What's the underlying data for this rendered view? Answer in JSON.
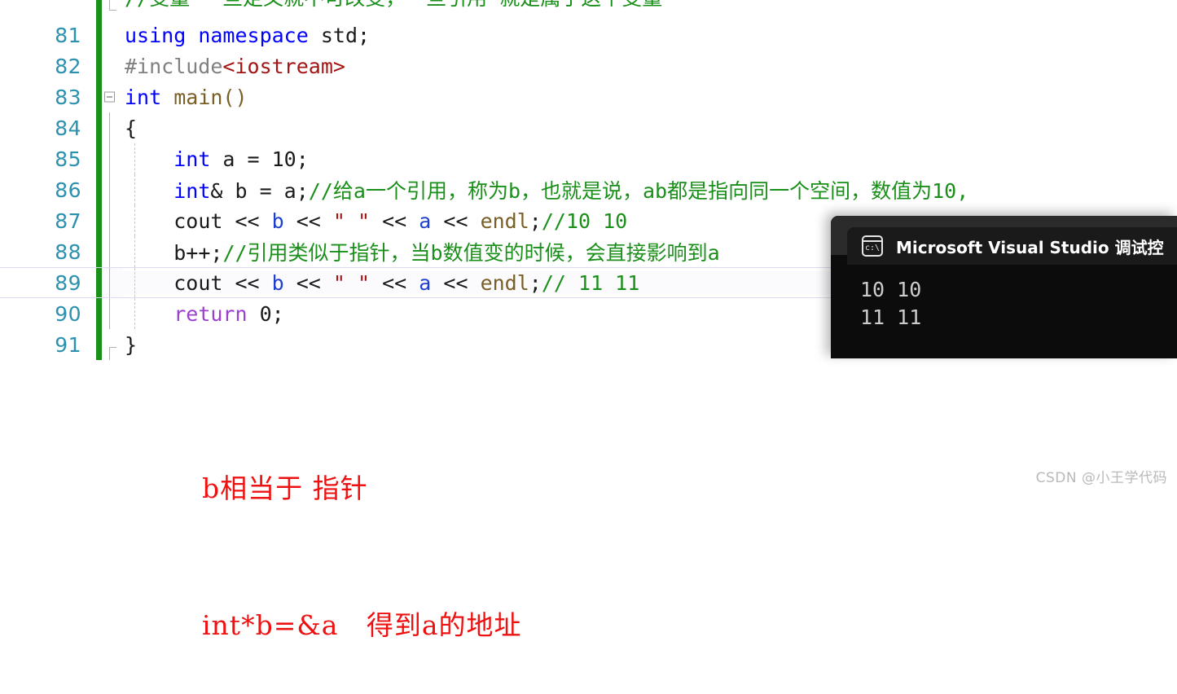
{
  "editor": {
    "partial_top_line": "//变量 一旦定义就不可改变，一旦引用 就是属于这个变量",
    "lines": [
      {
        "number": "81",
        "text": "using namespace std;"
      },
      {
        "number": "82",
        "text": "#include<iostream>"
      },
      {
        "number": "83",
        "text": "int main()"
      },
      {
        "number": "84",
        "text": "{"
      },
      {
        "number": "85",
        "text": "    int a = 10;"
      },
      {
        "number": "86",
        "text": "    int& b = a;//给a一个引用，称为b，也就是说，ab都是指向同一个空间，数值为10,"
      },
      {
        "number": "87",
        "text": "    cout << b << \" \" << a << endl;//10 10"
      },
      {
        "number": "88",
        "text": "    b++;//引用类似于指针，当b数值变的时候，会直接影响到a"
      },
      {
        "number": "89",
        "text": "    cout << b << \" \" << a << endl;// 11 11"
      },
      {
        "number": "90",
        "text": "    return 0;"
      },
      {
        "number": "91",
        "text": "}"
      }
    ],
    "tokens": {
      "kw_using": "using",
      "kw_namespace": "namespace",
      "id_std": "std;",
      "pre_include": "#include",
      "inc_iostream": "<iostream>",
      "kw_int": "int",
      "fn_main": "main()",
      "brace_open": "{",
      "brace_close": "}",
      "decl_a": "int",
      "decl_a_rest": " a = 10;",
      "decl_b_kw": "int",
      "decl_b_rest": "& b = a;",
      "cmt_86": "//给a一个引用，称为b，也就是说，ab都是指向同一个空间，数值为10,",
      "cout": "cout << ",
      "var_b": "b",
      "mid_op": " << ",
      "str_space": "\" \"",
      "var_a": "a",
      "endl": "endl",
      "semi": ";",
      "cmt_87": "//10 10",
      "code_88": "b++;",
      "cmt_88": "//引用类似于指针，当b数值变的时候，会直接影响到a",
      "cmt_89": "// 11 11",
      "kw_return": "return",
      "ret_val": " 0;"
    },
    "colors": {
      "keyword": "#0000ff",
      "comment": "#1a8f1a",
      "string": "#a31515",
      "function": "#795e26",
      "preprocessor": "#808080",
      "identifier": "#1f3fcf",
      "return_keyword": "#9a3fd0",
      "line_number": "#2b91af",
      "change_bar": "#1a8f1a",
      "background": "#ffffff"
    }
  },
  "console": {
    "icon": "console-cmd-icon",
    "icon_label": "c:\\",
    "title": "Microsoft Visual Studio 调试控",
    "output_lines": [
      "10 10",
      "11 11"
    ],
    "colors": {
      "background": "#0c0c0c",
      "titlebar": "#1a1a1a",
      "text": "#cccccc"
    }
  },
  "annotations": {
    "color": "#ee1111",
    "line1": "b相当于 指针",
    "line2": "int*b=&a   得到a的地址"
  },
  "watermark": {
    "text": "CSDN @小王学代码"
  }
}
